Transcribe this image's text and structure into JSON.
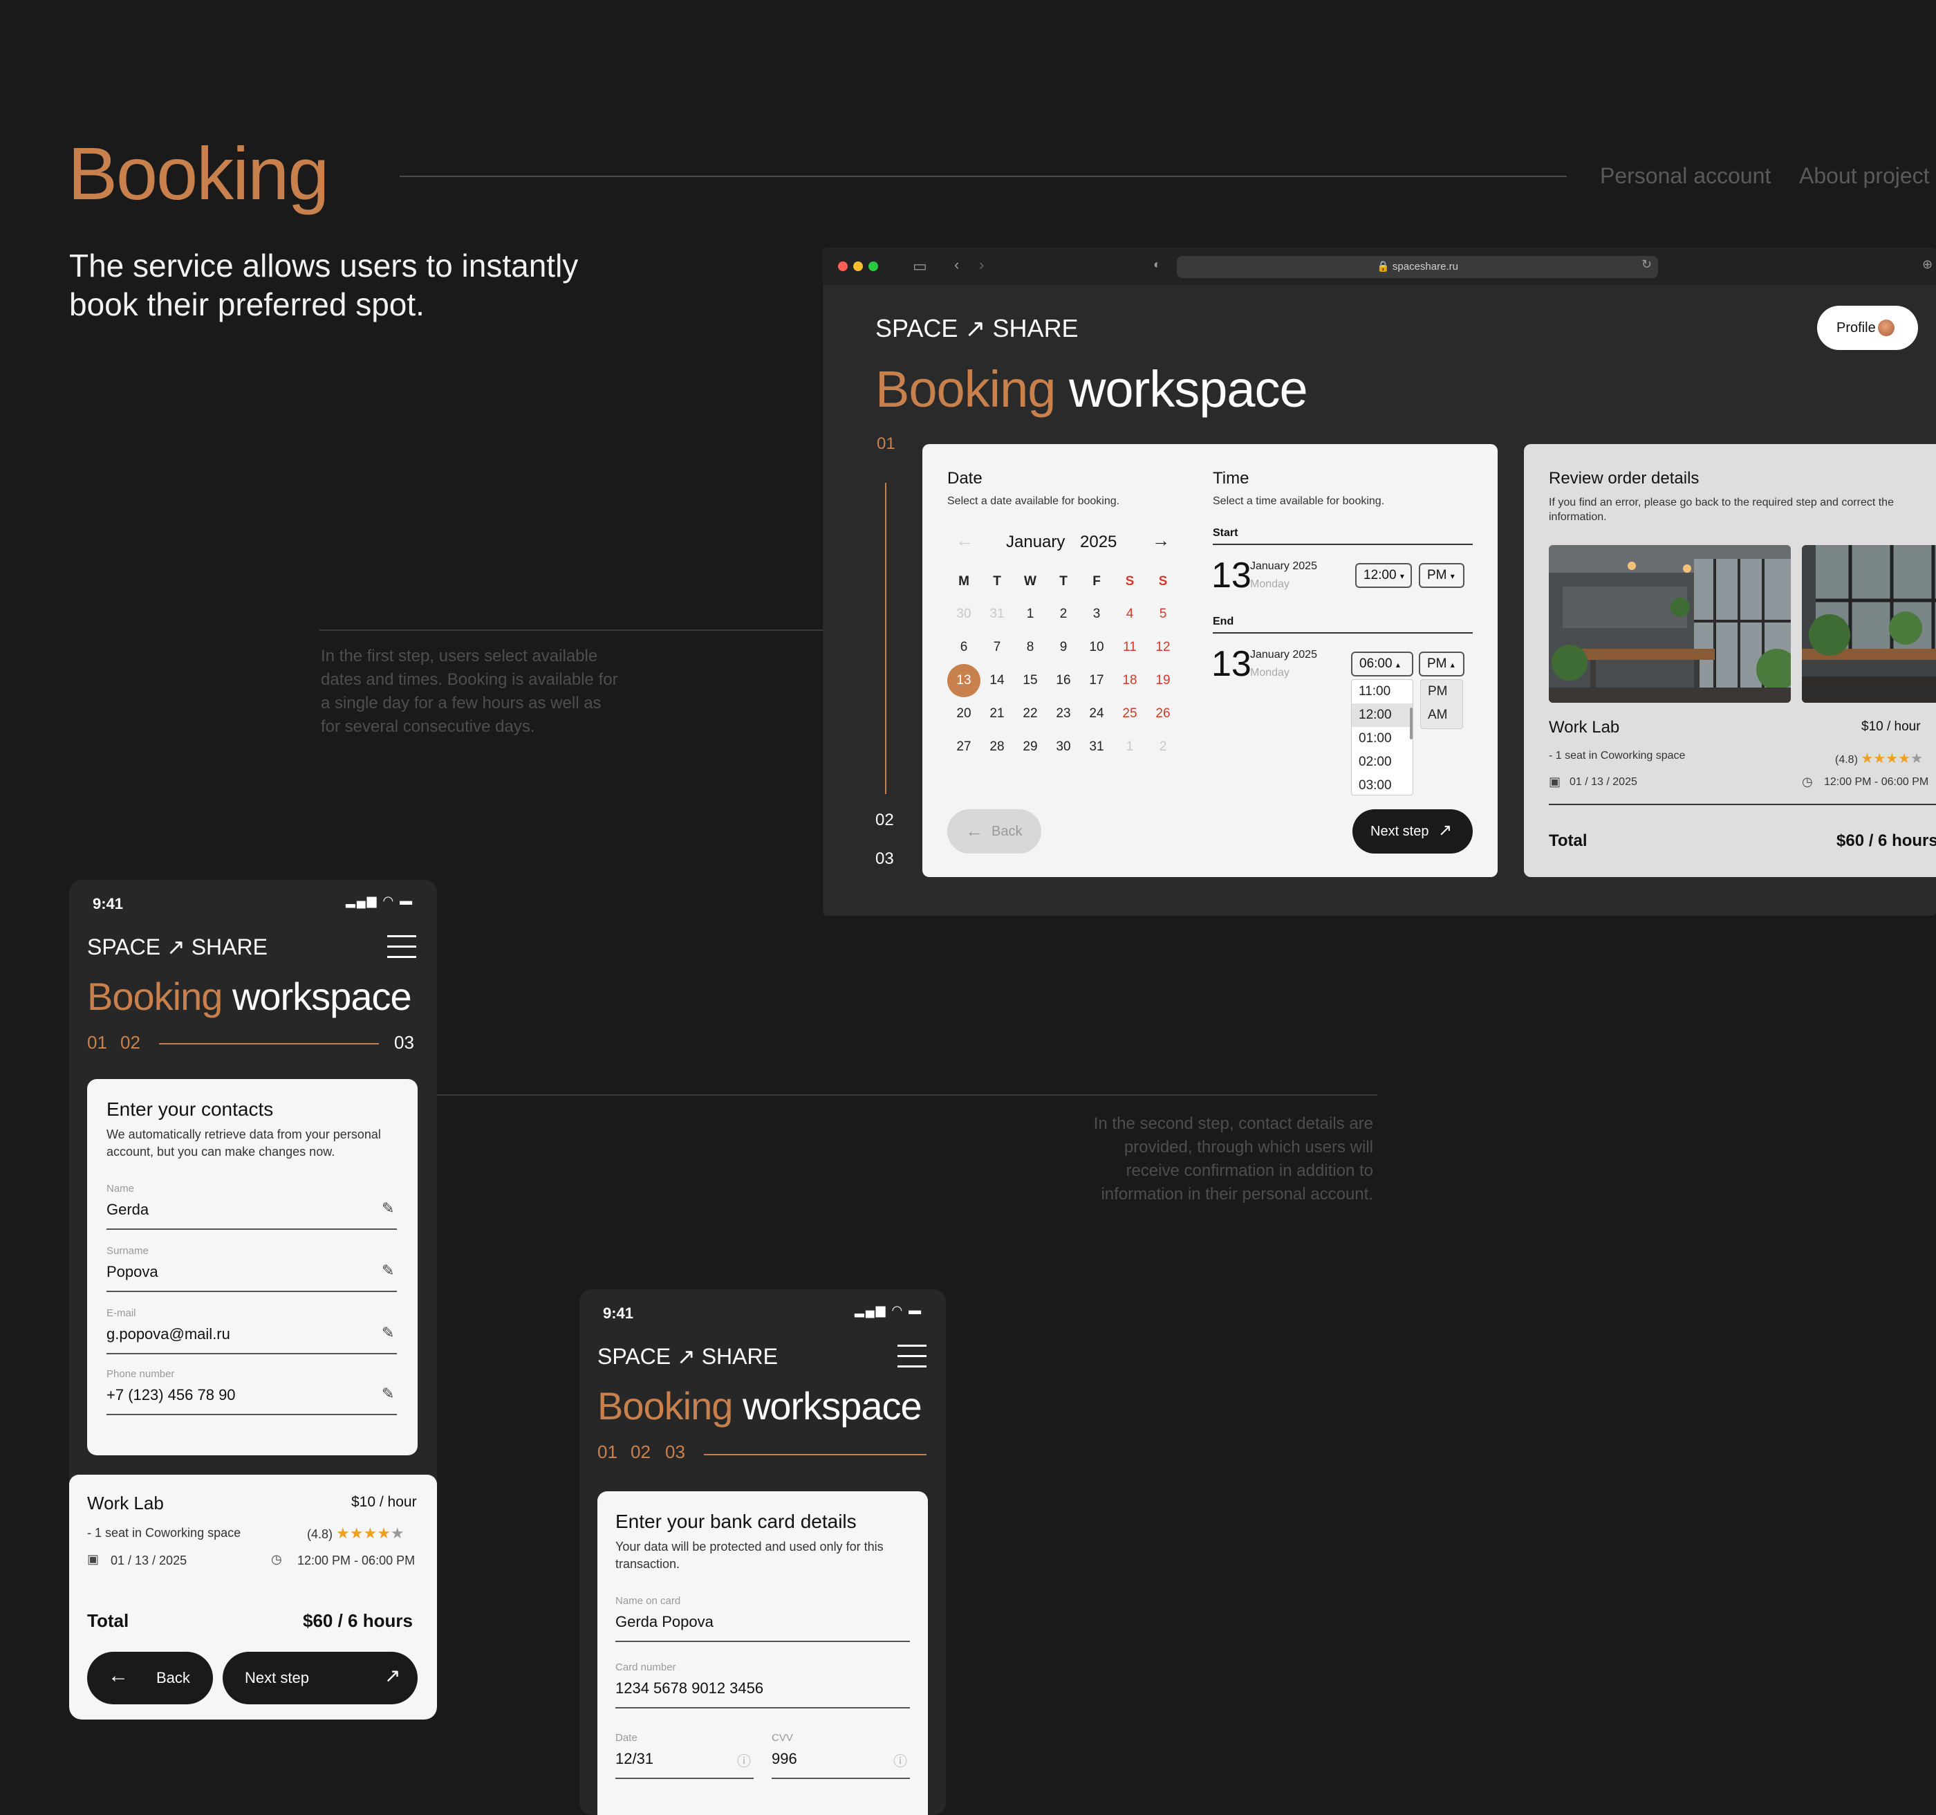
{
  "header": {
    "title": "Booking",
    "nav": [
      "Personal account",
      "About project"
    ],
    "intro": "The service allows users to instantly book their preferred spot."
  },
  "notes": {
    "step1": "In the first step, users select available dates and times. Booking is available for a single day for a few hours as well as for several consecutive days.",
    "step2": "In the second step, contact details are provided, through which users will receive confirmation in addition to information in their personal account."
  },
  "browser": {
    "url": "spaceshare.ru",
    "logo": "SPACE ↗ SHARE",
    "profile_label": "Profile",
    "heading_accent": "Booking",
    "heading_rest": "workspace",
    "steps": [
      "01",
      "02",
      "03"
    ],
    "date": {
      "title": "Date",
      "subtitle": "Select a date available for booking.",
      "month": "January",
      "year": "2025",
      "weekdays": [
        "M",
        "T",
        "W",
        "T",
        "F",
        "S",
        "S"
      ],
      "weeks": [
        [
          "30",
          "31",
          "1",
          "2",
          "3",
          "4",
          "5"
        ],
        [
          "6",
          "7",
          "8",
          "9",
          "10",
          "11",
          "12"
        ],
        [
          "13",
          "14",
          "15",
          "16",
          "17",
          "18",
          "19"
        ],
        [
          "20",
          "21",
          "22",
          "23",
          "24",
          "25",
          "26"
        ],
        [
          "27",
          "28",
          "29",
          "30",
          "31",
          "1",
          "2"
        ]
      ],
      "selected": "13"
    },
    "time": {
      "title": "Time",
      "subtitle": "Select a time available for booking.",
      "start_label": "Start",
      "end_label": "End",
      "start_day": "13",
      "start_month": "January 2025",
      "start_weekday": "Monday",
      "start_time": "12:00",
      "start_period": "PM",
      "end_day": "13",
      "end_month": "January 2025",
      "end_weekday": "Monday",
      "end_time": "06:00",
      "end_period": "PM",
      "time_options": [
        "11:00",
        "12:00",
        "01:00",
        "02:00",
        "03:00"
      ],
      "period_options": [
        "PM",
        "AM"
      ]
    },
    "back_label": "Back",
    "next_label": "Next step",
    "review": {
      "title": "Review order details",
      "subtitle": "If you find an error, please go back to the required step and correct the information.",
      "place": "Work Lab",
      "price": "$10 / hour",
      "seat": "- 1 seat in Coworking space",
      "rating": "(4.8)",
      "date": "01 / 13 / 2025",
      "time": "12:00 PM - 06:00 PM",
      "total_label": "Total",
      "total_value": "$60 / 6 hours"
    }
  },
  "phone1": {
    "time": "9:41",
    "logo": "SPACE ↗ SHARE",
    "heading_accent": "Booking",
    "heading_rest": "workspace",
    "steps": [
      "01",
      "02",
      "03"
    ],
    "card_title": "Enter your contacts",
    "card_subtitle": "We automatically retrieve data from your personal account, but you can make changes now.",
    "fields": [
      {
        "label": "Name",
        "value": "Gerda"
      },
      {
        "label": "Surname",
        "value": "Popova"
      },
      {
        "label": "E-mail",
        "value": "g.popova@mail.ru"
      },
      {
        "label": "Phone number",
        "value": "+7 (123) 456 78 90"
      }
    ],
    "summary": {
      "place": "Work Lab",
      "price": "$10 / hour",
      "seat": "- 1 seat in Coworking space",
      "rating": "(4.8)",
      "date": "01 / 13 / 2025",
      "time": "12:00 PM - 06:00 PM",
      "total_label": "Total",
      "total_value": "$60 / 6 hours"
    },
    "back_label": "Back",
    "next_label": "Next step"
  },
  "phone2": {
    "time": "9:41",
    "logo": "SPACE ↗ SHARE",
    "heading_accent": "Booking",
    "heading_rest": "workspace",
    "steps": [
      "01",
      "02",
      "03"
    ],
    "card_title": "Enter your bank card details",
    "card_subtitle": "Your data will be protected and used only for this transaction.",
    "name_label": "Name on card",
    "name_value": "Gerda Popova",
    "number_label": "Card number",
    "number_value": "1234 5678 9012 3456",
    "date_label": "Date",
    "date_value": "12/31",
    "cvv_label": "CVV",
    "cvv_value": "996"
  },
  "colors": {
    "accent": "#c8804d",
    "background": "#1a1a1a",
    "weekend": "#d43a2a"
  }
}
